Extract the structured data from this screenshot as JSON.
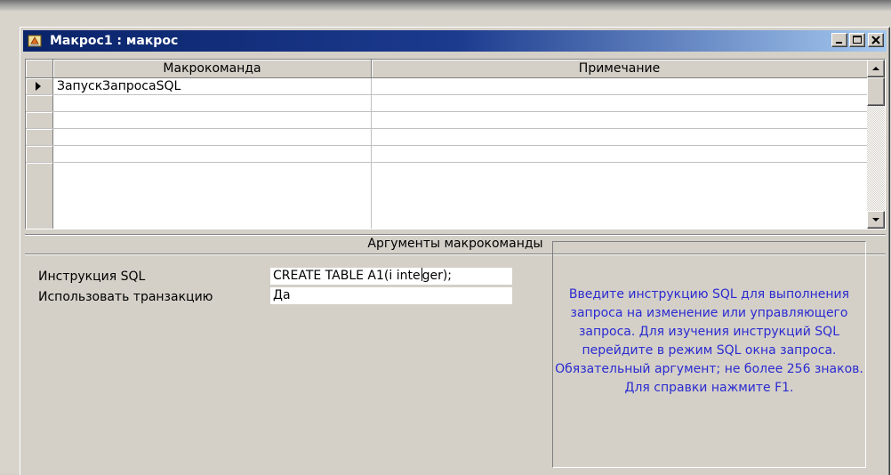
{
  "window": {
    "title": "Макрос1 : макрос",
    "titlebar_color": "#0a246a",
    "icon": "macro-icon",
    "controls": {
      "minimize": "minimize-icon",
      "maximize": "maximize-icon",
      "close": "close-icon"
    }
  },
  "grid": {
    "columns": [
      "Макрокоманда",
      "Примечание"
    ],
    "rows": [
      {
        "action": "ЗапускЗапросаSQL",
        "comment": "",
        "current": true
      },
      {
        "action": "",
        "comment": "",
        "current": false
      },
      {
        "action": "",
        "comment": "",
        "current": false
      },
      {
        "action": "",
        "comment": "",
        "current": false
      },
      {
        "action": "",
        "comment": "",
        "current": false
      },
      {
        "action": "",
        "comment": "",
        "current": false
      }
    ]
  },
  "arguments": {
    "title": "Аргументы макрокоманды",
    "fields": [
      {
        "label": "Инструкция SQL",
        "value_before_caret": "CREATE TABLE A1(i inte",
        "value_after_caret": "ger);"
      },
      {
        "label": "Использовать транзакцию",
        "value": "Да"
      }
    ],
    "help_text": "Введите инструкцию SQL для выполнения запроса на изменение или управляющего запроса. Для изучения инструкций SQL перейдите в режим SQL окна запроса. Обязательный аргумент; не более 256 знаков. Для справки нажмите F1.",
    "help_text_color": "#2b2bd0"
  }
}
